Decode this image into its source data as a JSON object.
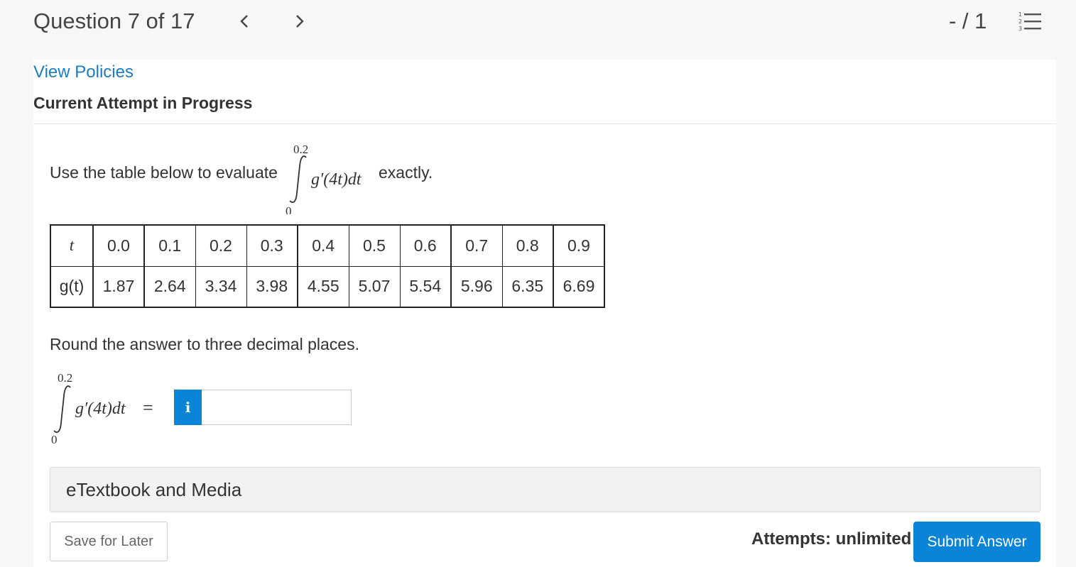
{
  "header": {
    "question_label": "Question 7 of 17",
    "score": "- / 1",
    "prev_icon": "chevron-left-icon",
    "next_icon": "chevron-right-icon",
    "list_icon": "numbered-list-icon"
  },
  "links": {
    "view_policies": "View Policies"
  },
  "attempt_heading": "Current Attempt in Progress",
  "question": {
    "prompt_before": "Use the table below to evaluate",
    "prompt_after": "exactly.",
    "integral": {
      "upper": "0.2",
      "lower": "0",
      "integrand": "g′(4t)dt"
    },
    "table": {
      "row1_header": "t",
      "row2_header": "g(t)",
      "t_values": [
        "0.0",
        "0.1",
        "0.2",
        "0.3",
        "0.4",
        "0.5",
        "0.6",
        "0.7",
        "0.8",
        "0.9"
      ],
      "g_values": [
        "1.87",
        "2.64",
        "3.34",
        "3.98",
        "4.55",
        "5.07",
        "5.54",
        "5.96",
        "6.35",
        "6.69"
      ]
    },
    "round_note": "Round the answer to three decimal places.",
    "answer_equals": "=",
    "info_button": "i",
    "answer_value": ""
  },
  "etextbook_label": "eTextbook and Media",
  "footer": {
    "save_label": "Save for Later",
    "attempts_label": "Attempts: unlimited",
    "submit_label": "Submit Answer"
  },
  "colors": {
    "accent": "#0a84d6",
    "link": "#1a7dc4"
  }
}
